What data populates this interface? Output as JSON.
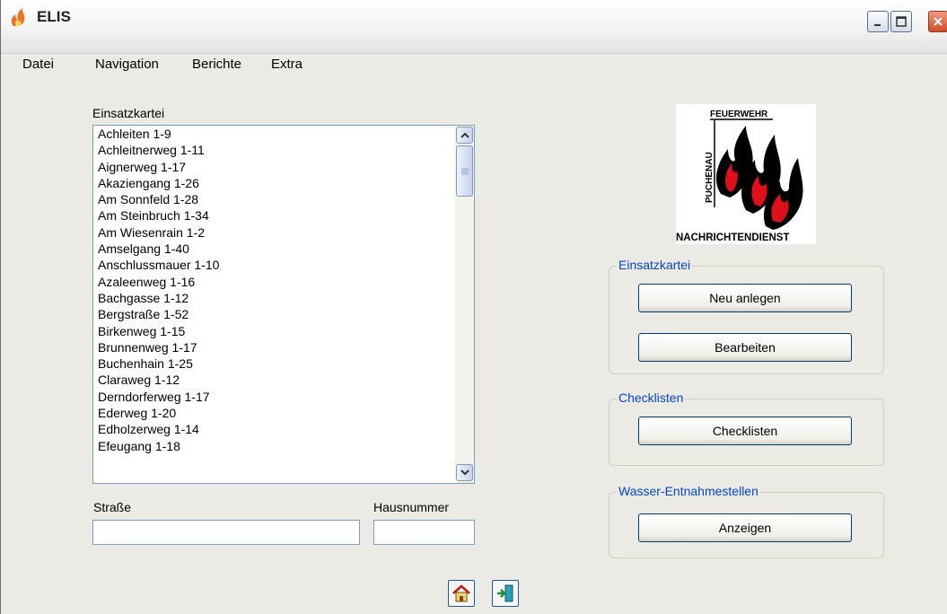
{
  "window": {
    "title": "ELIS",
    "colors": {
      "legend": "#0046d5",
      "border": "#7f9db9",
      "flame_red": "#e0101a"
    }
  },
  "menu": {
    "items": [
      "Datei",
      "Navigation",
      "Berichte",
      "Extra"
    ]
  },
  "list": {
    "label": "Einsatzkartei",
    "items": [
      "Achleiten 1-9",
      "Achleitnerweg 1-11",
      "Aignerweg 1-17",
      "Akaziengang 1-26",
      "Am Sonnfeld 1-28",
      "Am Steinbruch 1-34",
      "Am Wiesenrain 1-2",
      "Amselgang 1-40",
      "Anschlussmauer 1-10",
      "Azaleenweg 1-16",
      "Bachgasse 1-12",
      "Bergstraße 1-52",
      "Birkenweg 1-15",
      "Brunnenweg 1-17",
      "Buchenhain 1-25",
      "Claraweg 1-12",
      "Derndorferweg 1-17",
      "Ederweg 1-20",
      "Edholzerweg 1-14",
      "Efeugang 1-18"
    ]
  },
  "fields": {
    "strasse_label": "Straße",
    "strasse_value": "",
    "hausnummer_label": "Hausnummer",
    "hausnummer_value": ""
  },
  "logo": {
    "top_text": "FEUERWEHR",
    "side_text": "PUCHENAU",
    "bottom_text": "NACHRICHTENDIENST"
  },
  "groups": {
    "einsatzkartei": {
      "legend": "Einsatzkartei",
      "new_label": "Neu anlegen",
      "edit_label": "Bearbeiten"
    },
    "checklisten": {
      "legend": "Checklisten",
      "button_label": "Checklisten"
    },
    "wasser": {
      "legend": "Wasser-Entnahmestellen",
      "button_label": "Anzeigen"
    }
  },
  "toolbar": {
    "icons": [
      "home-icon",
      "exit-door-icon"
    ]
  }
}
